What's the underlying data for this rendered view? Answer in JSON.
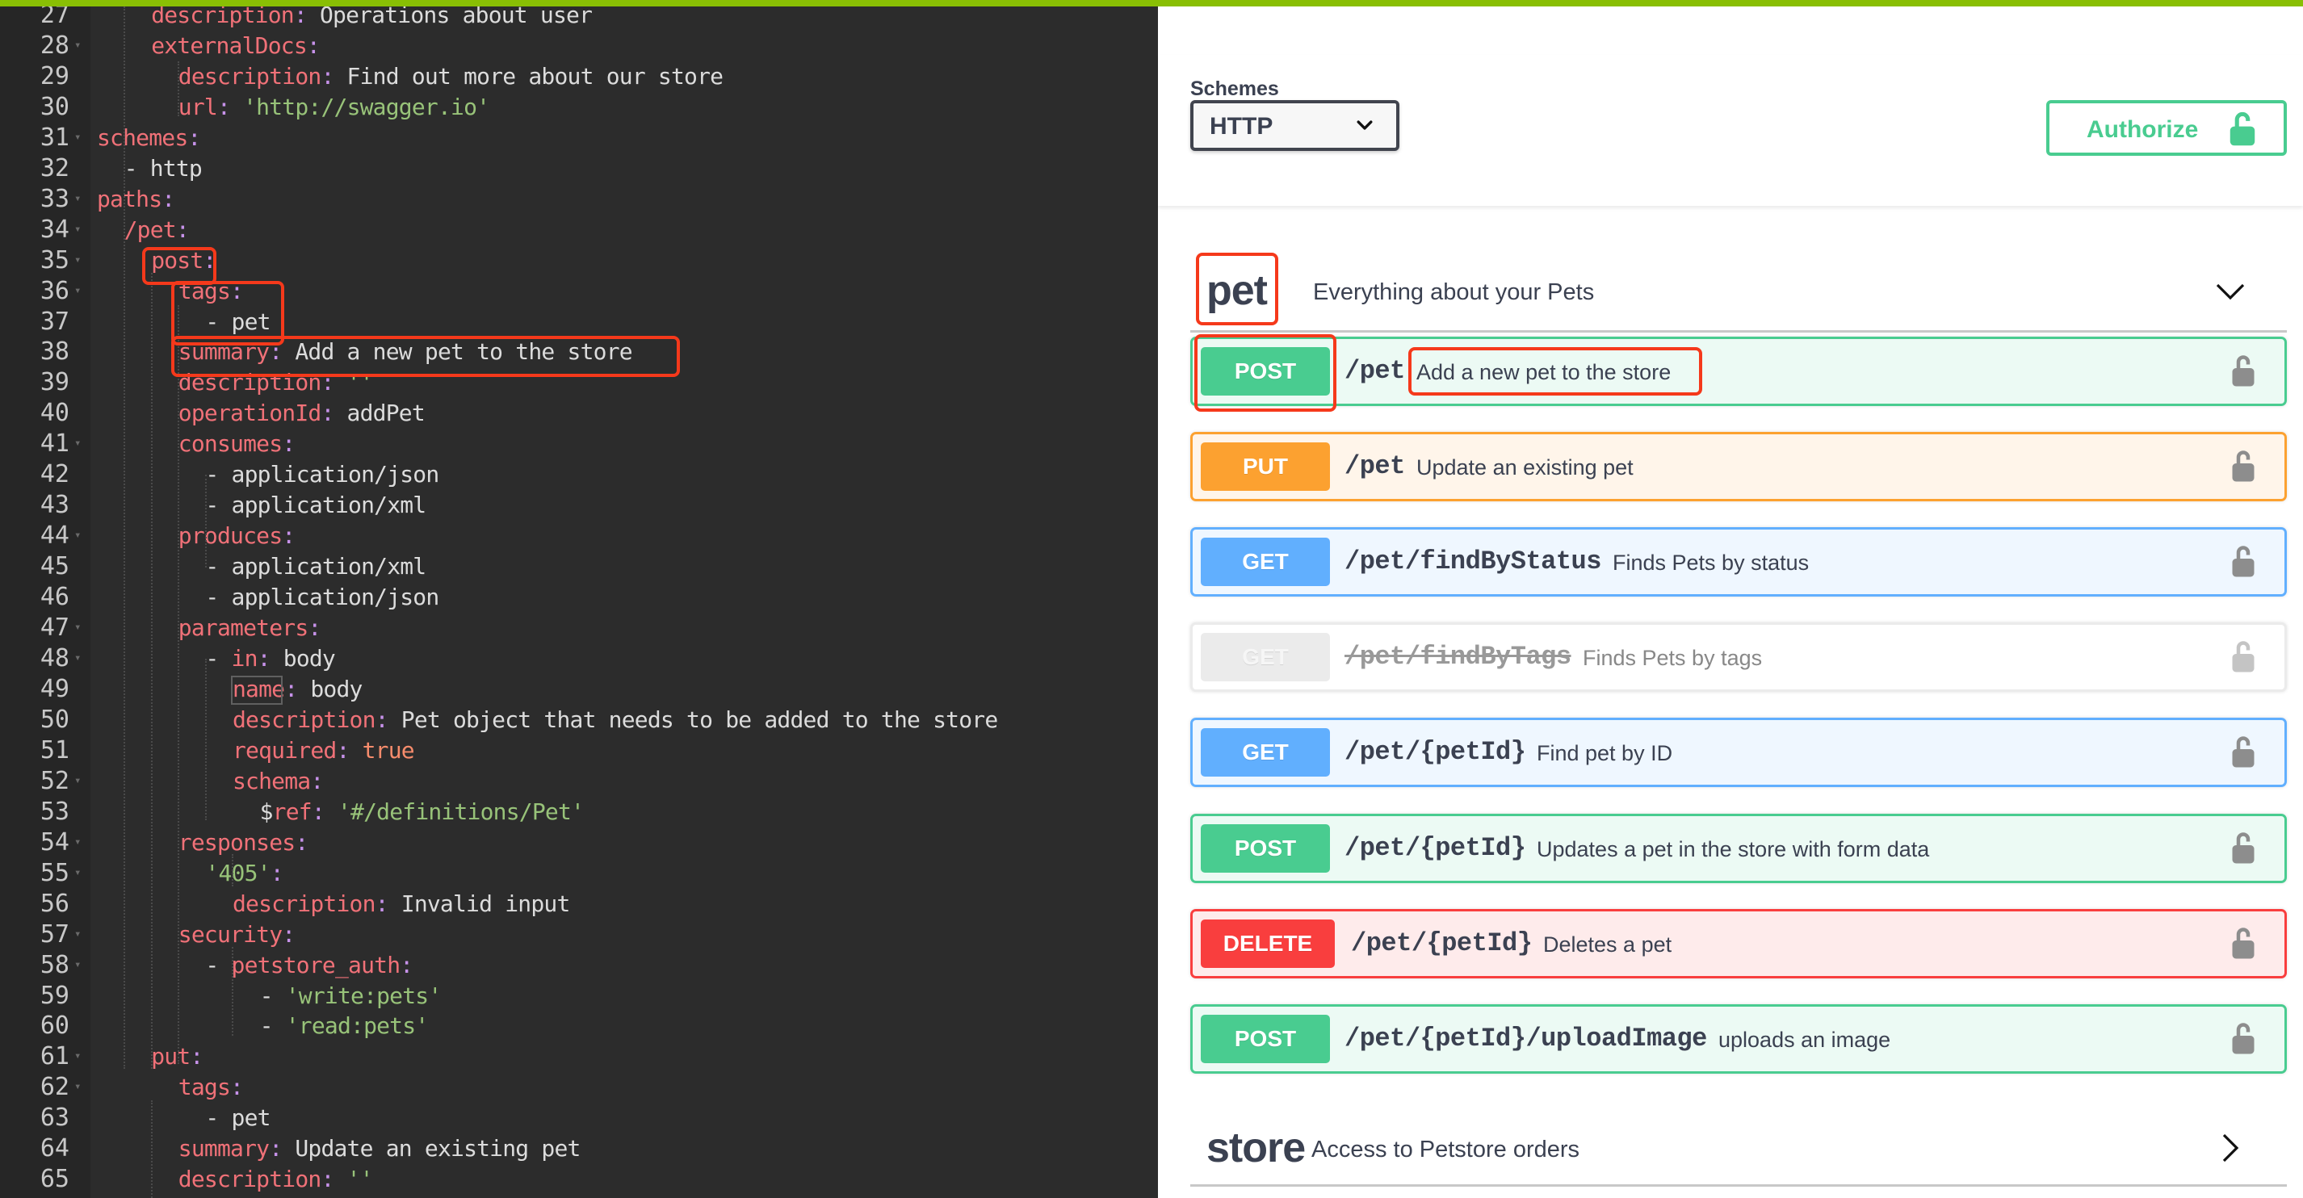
{
  "colors": {
    "topbar": "#89bf04",
    "post": "#49cc90",
    "put": "#fca130",
    "get": "#61affe",
    "delete": "#f93e3e",
    "deprecated": "#ebebeb",
    "annotation": "#f5391b"
  },
  "editor": {
    "lines": [
      {
        "n": "27",
        "fold": false,
        "indent": 2,
        "tokens": [
          [
            "k",
            "description"
          ],
          [
            "c",
            ":"
          ],
          [
            "p",
            " Operations about user"
          ]
        ]
      },
      {
        "n": "28",
        "fold": true,
        "indent": 2,
        "tokens": [
          [
            "k",
            "externalDocs"
          ],
          [
            "c",
            ":"
          ]
        ]
      },
      {
        "n": "29",
        "fold": false,
        "indent": 3,
        "tokens": [
          [
            "k",
            "description"
          ],
          [
            "c",
            ":"
          ],
          [
            "p",
            " Find out more about our store"
          ]
        ]
      },
      {
        "n": "30",
        "fold": false,
        "indent": 3,
        "tokens": [
          [
            "k",
            "url"
          ],
          [
            "c",
            ":"
          ],
          [
            "p",
            " "
          ],
          [
            "s",
            "'http://swagger.io'"
          ]
        ]
      },
      {
        "n": "31",
        "fold": true,
        "indent": 0,
        "tokens": [
          [
            "k",
            "schemes"
          ],
          [
            "c",
            ":"
          ]
        ]
      },
      {
        "n": "32",
        "fold": false,
        "indent": 1,
        "tokens": [
          [
            "p",
            "- http"
          ]
        ]
      },
      {
        "n": "33",
        "fold": true,
        "indent": 0,
        "tokens": [
          [
            "k",
            "paths"
          ],
          [
            "c",
            ":"
          ]
        ]
      },
      {
        "n": "34",
        "fold": true,
        "indent": 1,
        "tokens": [
          [
            "k",
            "/pet"
          ],
          [
            "c",
            ":"
          ]
        ]
      },
      {
        "n": "35",
        "fold": true,
        "indent": 2,
        "tokens": [
          [
            "k",
            "post"
          ],
          [
            "c",
            ":"
          ]
        ]
      },
      {
        "n": "36",
        "fold": true,
        "indent": 3,
        "tokens": [
          [
            "k",
            "tags"
          ],
          [
            "c",
            ":"
          ]
        ]
      },
      {
        "n": "37",
        "fold": false,
        "indent": 4,
        "tokens": [
          [
            "p",
            "- pet"
          ]
        ]
      },
      {
        "n": "38",
        "fold": false,
        "indent": 3,
        "tokens": [
          [
            "k",
            "summary"
          ],
          [
            "c",
            ":"
          ],
          [
            "p",
            " Add a new pet to the store"
          ]
        ]
      },
      {
        "n": "39",
        "fold": false,
        "indent": 3,
        "tokens": [
          [
            "k",
            "description"
          ],
          [
            "c",
            ":"
          ],
          [
            "p",
            " "
          ],
          [
            "s",
            "''"
          ]
        ]
      },
      {
        "n": "40",
        "fold": false,
        "indent": 3,
        "tokens": [
          [
            "k",
            "operationId"
          ],
          [
            "c",
            ":"
          ],
          [
            "p",
            " addPet"
          ]
        ]
      },
      {
        "n": "41",
        "fold": true,
        "indent": 3,
        "tokens": [
          [
            "k",
            "consumes"
          ],
          [
            "c",
            ":"
          ]
        ]
      },
      {
        "n": "42",
        "fold": false,
        "indent": 4,
        "tokens": [
          [
            "p",
            "- application/json"
          ]
        ]
      },
      {
        "n": "43",
        "fold": false,
        "indent": 4,
        "tokens": [
          [
            "p",
            "- application/xml"
          ]
        ]
      },
      {
        "n": "44",
        "fold": true,
        "indent": 3,
        "tokens": [
          [
            "k",
            "produces"
          ],
          [
            "c",
            ":"
          ]
        ]
      },
      {
        "n": "45",
        "fold": false,
        "indent": 4,
        "tokens": [
          [
            "p",
            "- application/xml"
          ]
        ]
      },
      {
        "n": "46",
        "fold": false,
        "indent": 4,
        "tokens": [
          [
            "p",
            "- application/json"
          ]
        ]
      },
      {
        "n": "47",
        "fold": true,
        "indent": 3,
        "tokens": [
          [
            "k",
            "parameters"
          ],
          [
            "c",
            ":"
          ]
        ]
      },
      {
        "n": "48",
        "fold": true,
        "indent": 4,
        "tokens": [
          [
            "p",
            "- "
          ],
          [
            "k",
            "in"
          ],
          [
            "c",
            ":"
          ],
          [
            "p",
            " body"
          ]
        ]
      },
      {
        "n": "49",
        "fold": false,
        "indent": 5,
        "tokens": [
          [
            "k",
            "name"
          ],
          [
            "c",
            ":"
          ],
          [
            "p",
            " body"
          ]
        ]
      },
      {
        "n": "50",
        "fold": false,
        "indent": 5,
        "tokens": [
          [
            "k",
            "description"
          ],
          [
            "c",
            ":"
          ],
          [
            "p",
            " Pet object that needs to be added to the store"
          ]
        ]
      },
      {
        "n": "51",
        "fold": false,
        "indent": 5,
        "tokens": [
          [
            "k",
            "required"
          ],
          [
            "c",
            ":"
          ],
          [
            "p",
            " "
          ],
          [
            "b",
            "true"
          ]
        ]
      },
      {
        "n": "52",
        "fold": true,
        "indent": 5,
        "tokens": [
          [
            "k",
            "schema"
          ],
          [
            "c",
            ":"
          ]
        ]
      },
      {
        "n": "53",
        "fold": false,
        "indent": 6,
        "tokens": [
          [
            "p",
            "$"
          ],
          [
            "k",
            "ref"
          ],
          [
            "c",
            ":"
          ],
          [
            "p",
            " "
          ],
          [
            "s",
            "'#/definitions/Pet'"
          ]
        ]
      },
      {
        "n": "54",
        "fold": true,
        "indent": 3,
        "tokens": [
          [
            "k",
            "responses"
          ],
          [
            "c",
            ":"
          ]
        ]
      },
      {
        "n": "55",
        "fold": true,
        "indent": 4,
        "tokens": [
          [
            "s",
            "'405'"
          ],
          [
            "c",
            ":"
          ]
        ]
      },
      {
        "n": "56",
        "fold": false,
        "indent": 5,
        "tokens": [
          [
            "k",
            "description"
          ],
          [
            "c",
            ":"
          ],
          [
            "p",
            " Invalid input"
          ]
        ]
      },
      {
        "n": "57",
        "fold": true,
        "indent": 3,
        "tokens": [
          [
            "k",
            "security"
          ],
          [
            "c",
            ":"
          ]
        ]
      },
      {
        "n": "58",
        "fold": true,
        "indent": 4,
        "tokens": [
          [
            "p",
            "- "
          ],
          [
            "k",
            "petstore_auth"
          ],
          [
            "c",
            ":"
          ]
        ]
      },
      {
        "n": "59",
        "fold": false,
        "indent": 6,
        "tokens": [
          [
            "p",
            "- "
          ],
          [
            "s",
            "'write:pets'"
          ]
        ]
      },
      {
        "n": "60",
        "fold": false,
        "indent": 6,
        "tokens": [
          [
            "p",
            "- "
          ],
          [
            "s",
            "'read:pets'"
          ]
        ]
      },
      {
        "n": "61",
        "fold": true,
        "indent": 2,
        "tokens": [
          [
            "k",
            "put"
          ],
          [
            "c",
            ":"
          ]
        ]
      },
      {
        "n": "62",
        "fold": true,
        "indent": 3,
        "tokens": [
          [
            "k",
            "tags"
          ],
          [
            "c",
            ":"
          ]
        ]
      },
      {
        "n": "63",
        "fold": false,
        "indent": 4,
        "tokens": [
          [
            "p",
            "- pet"
          ]
        ]
      },
      {
        "n": "64",
        "fold": false,
        "indent": 3,
        "tokens": [
          [
            "k",
            "summary"
          ],
          [
            "c",
            ":"
          ],
          [
            "p",
            " Update an existing pet"
          ]
        ]
      },
      {
        "n": "65",
        "fold": false,
        "indent": 3,
        "tokens": [
          [
            "k",
            "description"
          ],
          [
            "c",
            ":"
          ],
          [
            "p",
            " "
          ],
          [
            "s",
            "''"
          ]
        ]
      }
    ]
  },
  "swagger": {
    "schemes": {
      "label": "Schemes",
      "selected": "HTTP",
      "icon": "chevron-down-icon"
    },
    "authorize": {
      "label": "Authorize",
      "icon": "unlocked-icon"
    },
    "tags": [
      {
        "name": "pet",
        "description": "Everything about your Pets",
        "expanded": true,
        "icon": "chevron-down-icon",
        "operations": [
          {
            "method": "POST",
            "cls": "post",
            "path": "/pet",
            "summary": "Add a new pet to the store",
            "deprecated": false
          },
          {
            "method": "PUT",
            "cls": "put",
            "path": "/pet",
            "summary": "Update an existing pet",
            "deprecated": false
          },
          {
            "method": "GET",
            "cls": "get",
            "path": "/pet/findByStatus",
            "summary": "Finds Pets by status",
            "deprecated": false
          },
          {
            "method": "GET",
            "cls": "deprecated",
            "path": "/pet/findByTags",
            "summary": "Finds Pets by tags",
            "deprecated": true
          },
          {
            "method": "GET",
            "cls": "get",
            "path": "/pet/{petId}",
            "summary": "Find pet by ID",
            "deprecated": false
          },
          {
            "method": "POST",
            "cls": "post",
            "path": "/pet/{petId}",
            "summary": "Updates a pet in the store with form data",
            "deprecated": false
          },
          {
            "method": "DELETE",
            "cls": "delete",
            "path": "/pet/{petId}",
            "summary": "Deletes a pet",
            "deprecated": false
          },
          {
            "method": "POST",
            "cls": "post",
            "path": "/pet/{petId}/uploadImage",
            "summary": "uploads an image",
            "deprecated": false
          }
        ]
      },
      {
        "name": "store",
        "description": "Access to Petstore orders",
        "expanded": false,
        "icon": "chevron-right-icon",
        "operations": []
      }
    ]
  },
  "annotations": [
    {
      "target": "yaml-post-key",
      "label": "post"
    },
    {
      "target": "yaml-tags-block",
      "label": "tags: - pet"
    },
    {
      "target": "yaml-summary-line",
      "label": "summary: Add a new pet to the store"
    },
    {
      "target": "tag-name-pet",
      "label": "pet"
    },
    {
      "target": "method-badge-post",
      "label": "POST"
    },
    {
      "target": "operation-summary",
      "label": "Add a new pet to the store"
    }
  ]
}
